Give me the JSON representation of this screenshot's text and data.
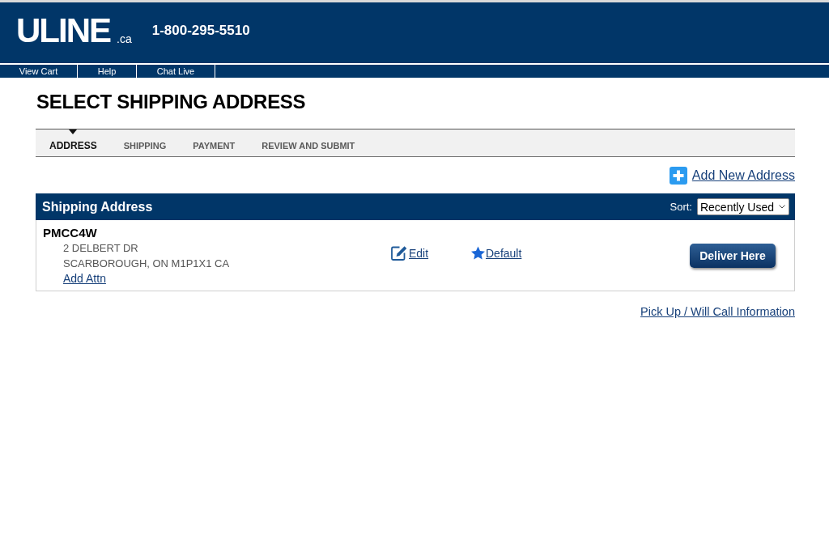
{
  "header": {
    "logo": "ULINE",
    "logo_domain": ".ca",
    "phone": "1-800-295-5510"
  },
  "top_nav": [
    "View Cart",
    "Help",
    "Chat Live"
  ],
  "page_title": "SELECT SHIPPING ADDRESS",
  "steps": [
    {
      "label": "ADDRESS",
      "selected": true
    },
    {
      "label": "SHIPPING",
      "selected": false
    },
    {
      "label": "PAYMENT",
      "selected": false
    },
    {
      "label": "REVIEW AND SUBMIT",
      "selected": false
    }
  ],
  "add_address_link": "Add New Address",
  "address_table": {
    "title": "Shipping Address",
    "sort_label": "Sort:",
    "sort_value": "Recently Used",
    "rows": [
      {
        "name": "PMCC4W",
        "address_lines": [
          "2 DELBERT DR",
          "SCARBOROUGH, ON M1P1X1 CA"
        ],
        "attn_link": "Add Attn",
        "edit_link": "Edit",
        "default_link": "Default",
        "button": "Deliver Here"
      }
    ]
  },
  "pickup_link": "Pick Up / Will Call Information"
}
